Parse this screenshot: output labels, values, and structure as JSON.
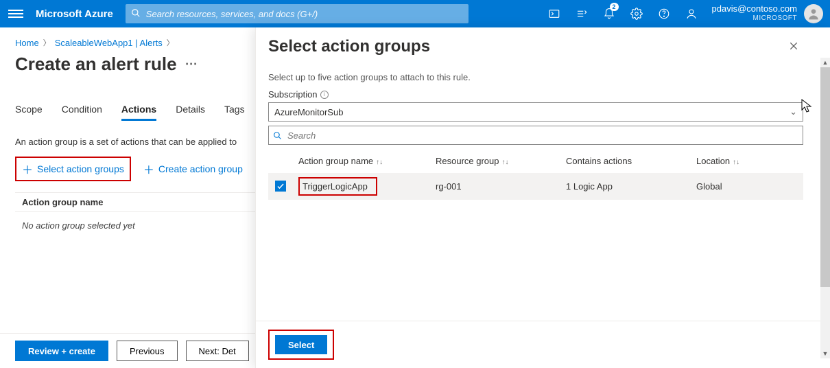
{
  "header": {
    "brand": "Microsoft Azure",
    "search_placeholder": "Search resources, services, and docs (G+/)",
    "notification_count": "2",
    "user_email": "pdavis@contoso.com",
    "tenant": "MICROSOFT"
  },
  "breadcrumbs": {
    "items": [
      "Home",
      "ScaleableWebApp1 | Alerts"
    ]
  },
  "page": {
    "title": "Create an alert rule"
  },
  "tabs": {
    "items": [
      "Scope",
      "Condition",
      "Actions",
      "Details",
      "Tags"
    ],
    "active": "Actions"
  },
  "main": {
    "description": "An action group is a set of actions that can be applied to",
    "select_btn": "Select action groups",
    "create_btn": "Create action group",
    "table_header": "Action group name",
    "empty_text": "No action group selected yet"
  },
  "footer": {
    "review": "Review + create",
    "previous": "Previous",
    "next": "Next: Det"
  },
  "flyout": {
    "title": "Select action groups",
    "subtitle": "Select up to five action groups to attach to this rule.",
    "subscription_label": "Subscription",
    "subscription_value": "AzureMonitorSub",
    "search_placeholder": "Search",
    "columns": {
      "name": "Action group name",
      "rg": "Resource group",
      "contains": "Contains actions",
      "location": "Location"
    },
    "row": {
      "name": "TriggerLogicApp",
      "rg": "rg-001",
      "contains": "1 Logic App",
      "location": "Global",
      "checked": true
    },
    "select_btn": "Select"
  }
}
